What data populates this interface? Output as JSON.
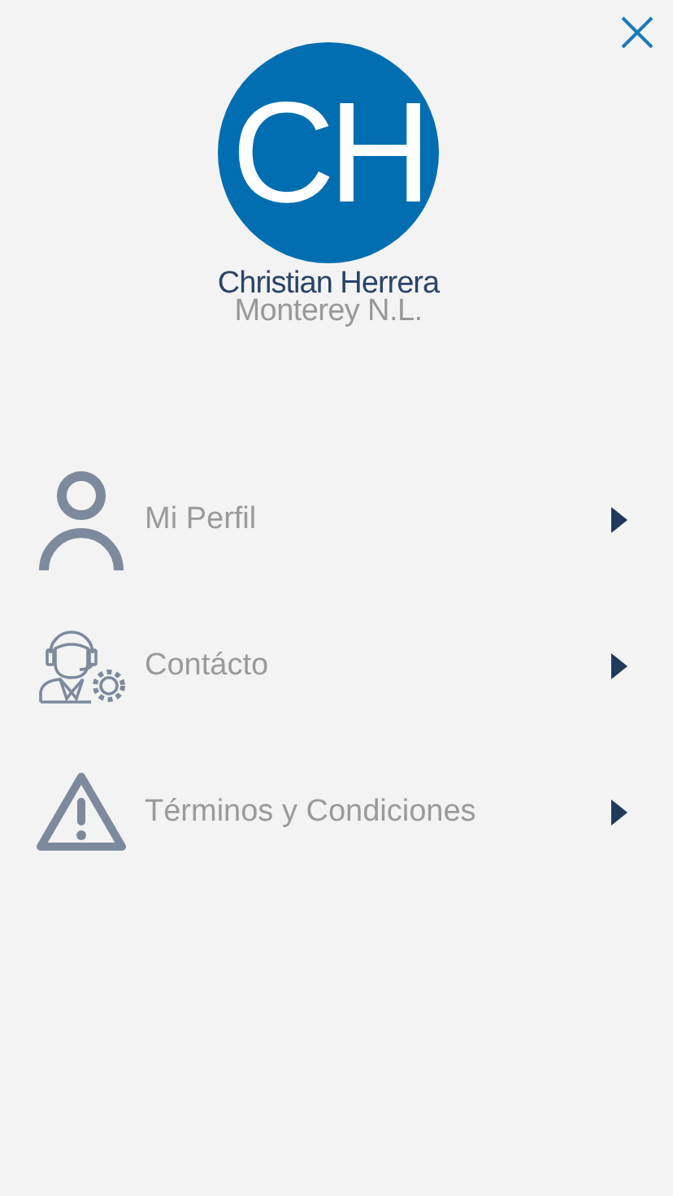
{
  "profile": {
    "initials": "CH",
    "name": "Christian Herrera",
    "location": "Monterey N.L."
  },
  "menu": [
    {
      "kind": "person",
      "label": "Mi Perfil"
    },
    {
      "kind": "support",
      "label": "Contácto"
    },
    {
      "kind": "warning",
      "label": "Términos y Condiciones"
    }
  ]
}
